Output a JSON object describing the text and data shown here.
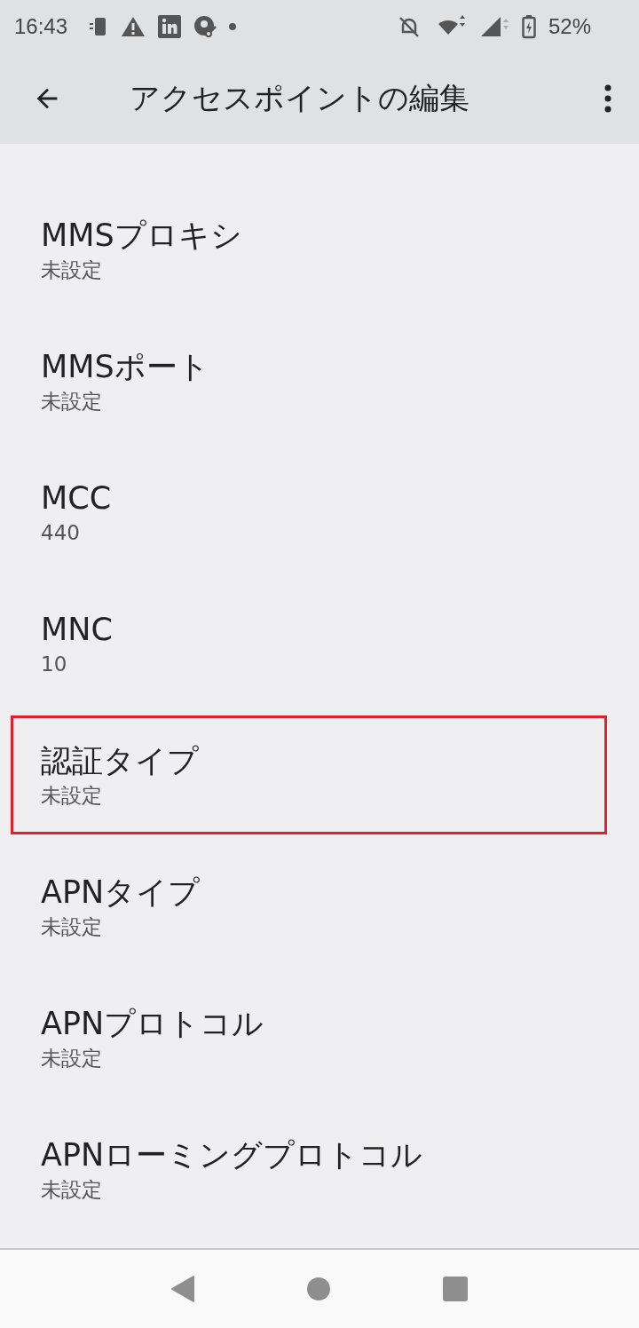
{
  "status_bar": {
    "time": "16:43",
    "battery": "52%"
  },
  "app_bar": {
    "title": "アクセスポイントの編集"
  },
  "items": [
    {
      "title": "MMSプロキシ",
      "summary": "未設定",
      "highlighted": false
    },
    {
      "title": "MMSポート",
      "summary": "未設定",
      "highlighted": false
    },
    {
      "title": "MCC",
      "summary": "440",
      "highlighted": false
    },
    {
      "title": "MNC",
      "summary": "10",
      "highlighted": false
    },
    {
      "title": "認証タイプ",
      "summary": "未設定",
      "highlighted": true
    },
    {
      "title": "APNタイプ",
      "summary": "未設定",
      "highlighted": false
    },
    {
      "title": "APNプロトコル",
      "summary": "未設定",
      "highlighted": false
    },
    {
      "title": "APNローミングプロトコル",
      "summary": "未設定",
      "highlighted": false
    }
  ]
}
